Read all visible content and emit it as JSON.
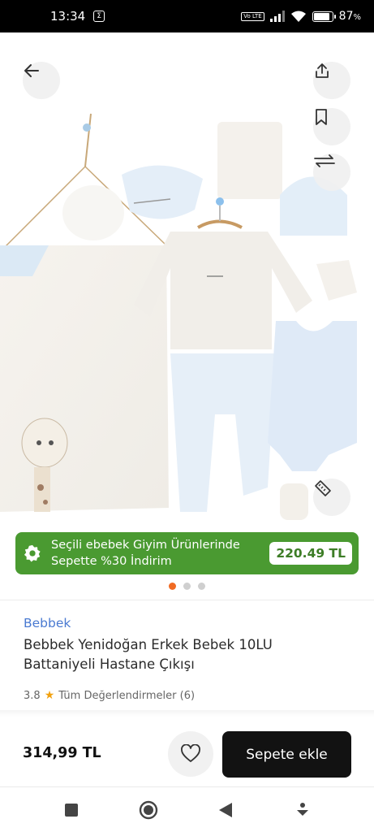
{
  "status_bar": {
    "time": "13:34",
    "notification_badge": "Σ",
    "network_tag": "Vo LTE",
    "battery_percent": "87",
    "battery_unit": "%",
    "battery_level": 0.87
  },
  "gallery": {
    "icons": {
      "back": "arrow-left-icon",
      "share": "share-icon",
      "favorite": "bookmark-icon",
      "compare": "compare-arrows-icon",
      "size_guide": "ruler-icon"
    },
    "page_count": 3,
    "active_page": 1
  },
  "promo": {
    "line1": "Seçili ebebek Giyim Ürünlerinde",
    "line2": "Sepette %30 İndirim",
    "price": "220.49 TL",
    "color": "#4a9a31"
  },
  "product": {
    "brand": "Bebbek",
    "title": "Bebbek Yenidoğan Erkek Bebek 10LU Battaniyeli Hastane Çıkışı",
    "rating": "3.8",
    "reviews_label": "Tüm Değerlendirmeler (6)"
  },
  "purchase": {
    "price": "314,99 TL",
    "add_to_cart": "Sepete ekle"
  },
  "colors": {
    "accent": "#f06a22",
    "brand_link": "#4a7ad1",
    "cta": "#121212"
  }
}
